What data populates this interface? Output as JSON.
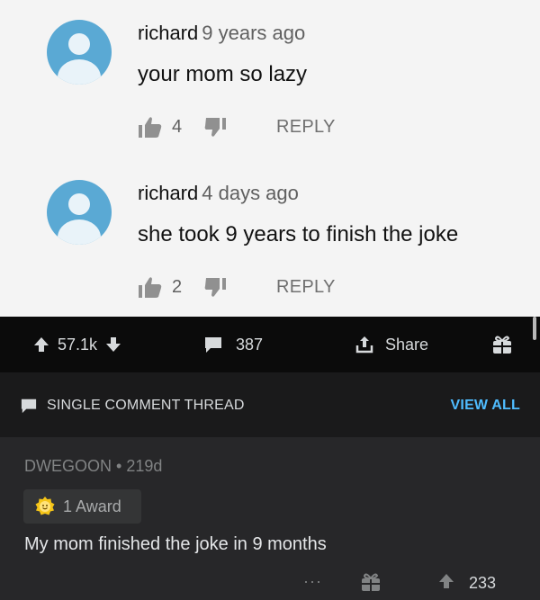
{
  "youtube": {
    "comments": [
      {
        "author": "richard",
        "time": "9 years ago",
        "text": "your mom so lazy",
        "likes": "4",
        "reply_label": "REPLY"
      },
      {
        "author": "richard",
        "time": "4 days ago",
        "text": "she took 9 years to finish the joke",
        "likes": "2",
        "reply_label": "REPLY"
      }
    ]
  },
  "post_bar": {
    "score": "57.1k",
    "comments": "387",
    "share_label": "Share",
    "icons": [
      "upvote-icon",
      "downvote-icon",
      "comment-icon",
      "share-icon",
      "gift-icon"
    ]
  },
  "thread_header": {
    "label": "SINGLE COMMENT THREAD",
    "view_all": "VIEW ALL"
  },
  "reddit_comment": {
    "author": "DWEGOON",
    "separator": "•",
    "age": "219d",
    "award": "1 Award",
    "body": "My mom finished the joke in 9 months",
    "more": "···",
    "score": "233"
  },
  "colors": {
    "link_blue": "#4fbcff",
    "avatar_blue": "#5aa9d4",
    "dark_bg": "#1a1a1b",
    "comment_bg": "#272729"
  }
}
